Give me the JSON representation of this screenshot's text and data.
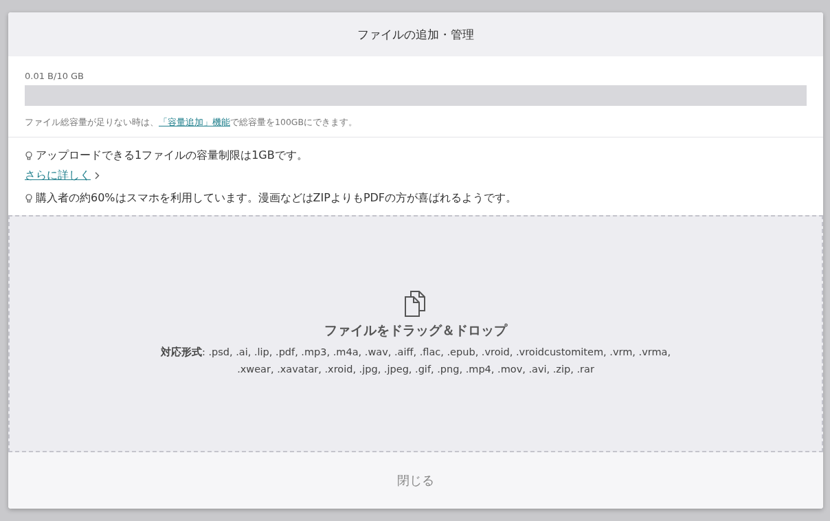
{
  "dialog": {
    "title": "ファイルの追加・管理"
  },
  "storage": {
    "usage": "0.01 B/10 GB",
    "level": 0,
    "note_before": "ファイル総容量が足りない時は、",
    "note_link": "「容量追加」機能",
    "note_after": "で総容量を100GBにできます。"
  },
  "tips": [
    {
      "text": "アップロードできる1ファイルの容量制限は1GBです。",
      "link": "さらに詳しく"
    },
    {
      "text": "購入者の約60%はスマホを利用しています。漫画などはZIPよりもPDFの方が喜ばれるようです。"
    }
  ],
  "dropzone": {
    "title": "ファイルをドラッグ＆ドロップ",
    "formats": "**対応形式**: .psd, .ai, .lip, .pdf, .mp3, .m4a, .wav, .aiff, .flac, .epub, .vroid, .vroidcustomitem, .vrm, .vrma, .xwear, .xavatar, .xroid, .jpg, .jpeg, .gif, .png, .mp4, .mov, .avi, .zip, .rar"
  },
  "footer": {
    "close": "閉じる"
  }
}
